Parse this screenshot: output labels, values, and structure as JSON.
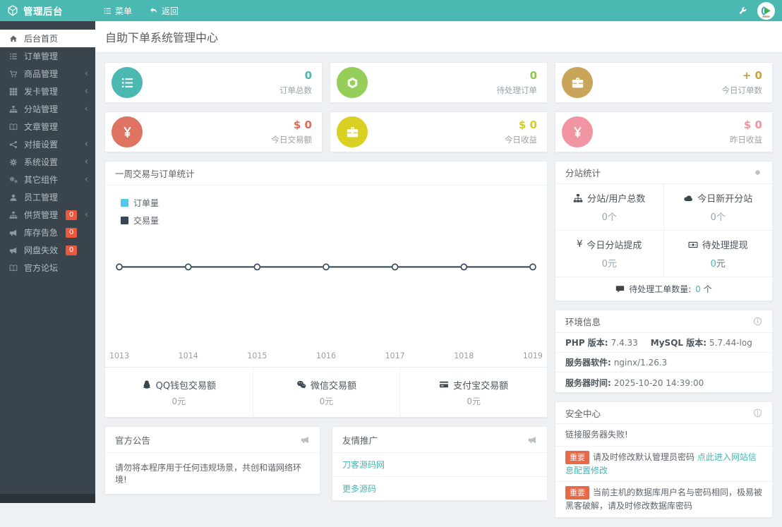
{
  "navbar": {
    "brand": "管理后台",
    "menu": "菜单",
    "back": "返回"
  },
  "sidebar": {
    "chevron": "‹",
    "items": [
      {
        "label": "后台首页",
        "icon": "home-icon",
        "active": true
      },
      {
        "label": "订单管理",
        "icon": "list-icon"
      },
      {
        "label": "商品管理",
        "icon": "cart-icon",
        "chevron": true
      },
      {
        "label": "发卡管理",
        "icon": "grid-icon",
        "chevron": true
      },
      {
        "label": "分站管理",
        "icon": "sitemap-icon",
        "chevron": true
      },
      {
        "label": "文章管理",
        "icon": "book-icon"
      },
      {
        "label": "对接设置",
        "icon": "share-icon",
        "chevron": true
      },
      {
        "label": "系统设置",
        "icon": "gear-icon",
        "chevron": true
      },
      {
        "label": "其它组件",
        "icon": "cogs-icon",
        "chevron": true
      },
      {
        "label": "员工管理",
        "icon": "user-icon"
      },
      {
        "label": "供货管理",
        "icon": "sitemap-icon",
        "badge": "0",
        "chevron": true
      },
      {
        "label": "库存告急",
        "icon": "bullhorn-icon",
        "badge": "0"
      },
      {
        "label": "网盘失效",
        "icon": "bullhorn-icon",
        "badge": "0"
      },
      {
        "label": "官方论坛",
        "icon": "book-icon"
      }
    ]
  },
  "page": {
    "title": "自助下单系统管理中心"
  },
  "stats": [
    {
      "value": "0",
      "label": "订单总数",
      "color": "#4cb8b2",
      "icon": "list-icon"
    },
    {
      "value": "0",
      "label": "待处理订单",
      "color": "#8fc843",
      "icon": "hexagon-icon"
    },
    {
      "value": "+ 0",
      "label": "今日订单数",
      "color": "#c9a145",
      "icon": "briefcase-icon"
    },
    {
      "value": "$ 0",
      "label": "今日交易额",
      "color": "#dd6b55",
      "icon": "yen-icon"
    },
    {
      "value": "$ 0",
      "label": "今日收益",
      "color": "#d6cd1e",
      "icon": "briefcase-icon"
    },
    {
      "value": "$ 0",
      "label": "昨日收益",
      "color": "#f093a0",
      "icon": "yen-icon"
    }
  ],
  "chart_data": {
    "type": "line",
    "title": "一周交易与订单统计",
    "categories": [
      "1013",
      "1014",
      "1015",
      "1016",
      "1017",
      "1018",
      "1019"
    ],
    "series": [
      {
        "name": "订单量",
        "values": [
          0,
          0,
          0,
          0,
          0,
          0,
          0
        ],
        "color": "#4fc7ee"
      },
      {
        "name": "交易量",
        "values": [
          0,
          0,
          0,
          0,
          0,
          0,
          0
        ],
        "color": "#37475a"
      }
    ],
    "ylim": [
      -1,
      1
    ],
    "grid": false,
    "legend_position": "top-left"
  },
  "payments": [
    {
      "label": "QQ钱包交易额",
      "value": "0元",
      "icon": "qq-icon"
    },
    {
      "label": "微信交易额",
      "value": "0元",
      "icon": "wechat-icon"
    },
    {
      "label": "支付宝交易额",
      "value": "0元",
      "icon": "credit-card-icon"
    }
  ],
  "announce": {
    "title": "官方公告",
    "text": "请勿将本程序用于任何违规场景，共创和谐网络环境!"
  },
  "promo": {
    "title": "友情推广",
    "links": [
      "刀客源码网",
      "更多源码"
    ]
  },
  "substation": {
    "title": "分站统计",
    "cells": [
      {
        "label": "分站/用户总数",
        "value": "0个",
        "icon": "sitemap-icon"
      },
      {
        "label": "今日新开分站",
        "value": "0个",
        "icon": "cloud-icon"
      },
      {
        "label": "今日分站提成",
        "value": "0元",
        "icon": "yen-icon"
      },
      {
        "label": "待处理提现",
        "num": "0",
        "unit": "元",
        "icon": "money-icon"
      }
    ],
    "footer_label": "待处理工单数量:",
    "footer_num": "0",
    "footer_unit": "个"
  },
  "env": {
    "title": "环境信息",
    "php_k": "PHP 版本:",
    "php_v": "7.4.33",
    "mysql_k": "MySQL 版本:",
    "mysql_v": "5.7.44-log",
    "soft_k": "服务器软件:",
    "soft_v": "nginx/1.26.3",
    "time_k": "服务器时间:",
    "time_v": "2025-10-20 14:39:00"
  },
  "security": {
    "title": "安全中心",
    "row1": "链接服务器失败!",
    "badge": "重要",
    "row2_text": "请及时修改默认管理员密码",
    "row2_link": "点此进入网站信息配置修改",
    "row3_text": "当前主机的数据库用户名与密码相同，极易被黑客破解，请及时修改数据库密码"
  },
  "theme": {
    "navbar": "#4cb8b2",
    "sidebar": "#3a444c",
    "link": "#45b6b0",
    "badge": "#e8593f",
    "important_badge": "#e8684a",
    "stat_colors": [
      "#4cb8b2",
      "#8fc843",
      "#c9a145",
      "#dd6b55",
      "#d6cd1e",
      "#f093a0"
    ],
    "legend_orders": "#4fc7ee",
    "legend_trades": "#37475a"
  }
}
